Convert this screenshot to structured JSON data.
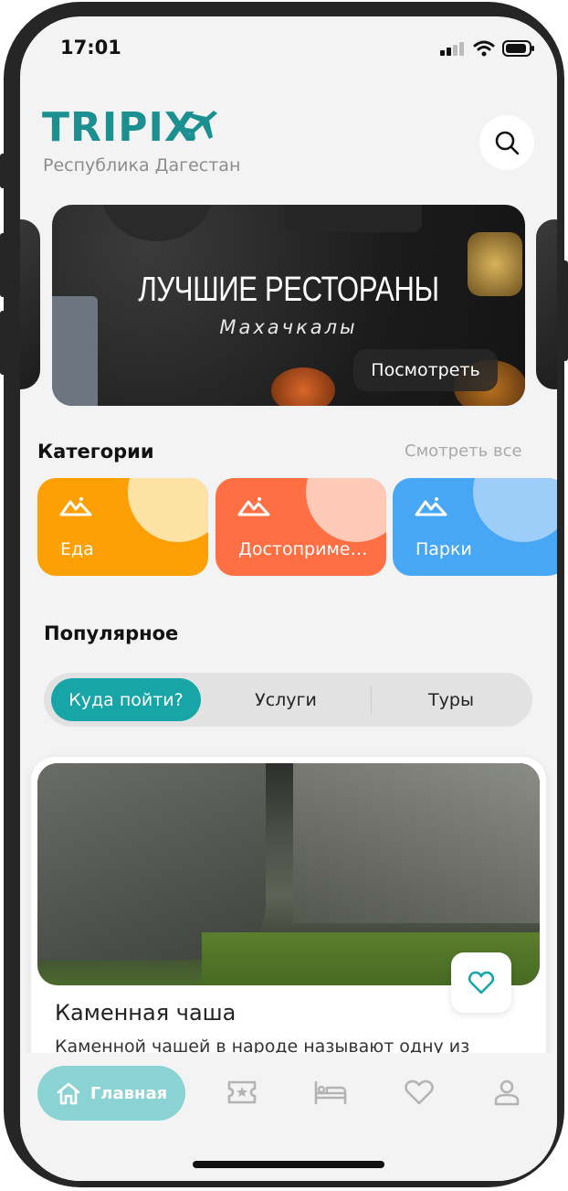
{
  "status_bar": {
    "time": "17:01"
  },
  "header": {
    "logo_text": "TRIPIX",
    "logo_icon": "airplane-icon",
    "region": "Республика Дагестан",
    "search_icon": "search-icon"
  },
  "banner": {
    "title": "ЛУЧШИЕ РЕСТОРАНЫ",
    "subtitle": "Махачкалы",
    "button_label": "Посмотреть"
  },
  "categories": {
    "title": "Категории",
    "see_all": "Смотреть все",
    "items": [
      {
        "label": "Еда",
        "color": "#fda006",
        "bubble": "#fde2a6",
        "icon": "mountain-icon"
      },
      {
        "label": "Достопримечательности",
        "color": "#fe6f43",
        "bubble": "#fdcab8",
        "icon": "mountain-icon"
      },
      {
        "label": "Парки",
        "color": "#47a7f4",
        "bubble": "#9ecdfa",
        "icon": "mountain-icon"
      }
    ]
  },
  "popular": {
    "title": "Популярное",
    "tabs": [
      {
        "label": "Куда пойти?",
        "active": true
      },
      {
        "label": "Услуги",
        "active": false
      },
      {
        "label": "Туры",
        "active": false
      }
    ]
  },
  "place": {
    "name": "Каменная чаша",
    "description": "Каменной чашей в народе называют одну из",
    "favorite_icon": "heart-icon"
  },
  "bottom_nav": {
    "home_label": "Главная",
    "items": [
      "home-icon",
      "ticket-icon",
      "bed-icon",
      "heart-icon",
      "profile-icon"
    ]
  },
  "colors": {
    "brand": "#1c8f91",
    "accent": "#17a5a8",
    "nav_active": "#8ad2d3"
  }
}
